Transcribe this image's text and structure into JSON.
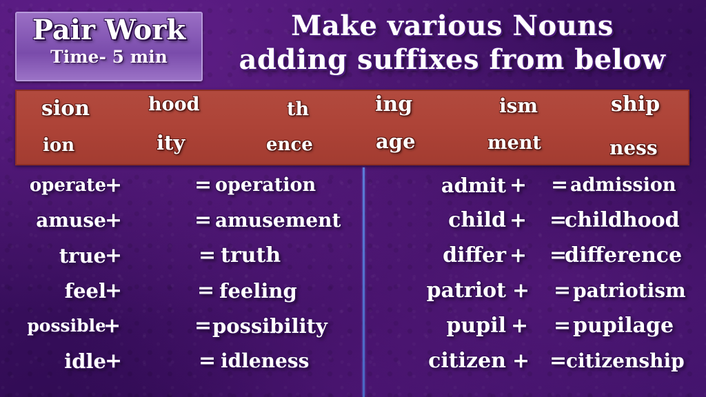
{
  "badge": {
    "title": "Pair Work",
    "subtitle": "Time- 5 min"
  },
  "heading": {
    "line1": "Make various Nouns",
    "line2": "adding suffixes from below"
  },
  "suffix_bar": {
    "row1": [
      "sion",
      "hood",
      "th",
      "ing",
      "ism",
      "ship"
    ],
    "row2": [
      "ion",
      "ity",
      "ence",
      "age",
      "ment",
      "ness"
    ]
  },
  "left_column": [
    {
      "base": "operate",
      "op": "+",
      "eq": "=",
      "result": "operation"
    },
    {
      "base": "amuse",
      "op": "+",
      "eq": "=",
      "result": "amusement"
    },
    {
      "base": "true",
      "op": "+",
      "eq": "=",
      "result": "truth"
    },
    {
      "base": "feel",
      "op": "+",
      "eq": "=",
      "result": "feeling"
    },
    {
      "base": "possible",
      "op": "+",
      "eq": "=",
      "result": "possibility"
    },
    {
      "base": "idle",
      "op": "+",
      "eq": "=",
      "result": "idleness"
    }
  ],
  "right_column": [
    {
      "base": "admit",
      "op": "+",
      "eq": "=",
      "result": "admission"
    },
    {
      "base": "child",
      "op": "+",
      "eq": "=",
      "result": "childhood"
    },
    {
      "base": "differ",
      "op": "+",
      "eq": "=",
      "result": "difference"
    },
    {
      "base": "patriot",
      "op": "+",
      "eq": "=",
      "result": "patriotism"
    },
    {
      "base": "pupil",
      "op": "+",
      "eq": "=",
      "result": "pupilage"
    },
    {
      "base": "citizen",
      "op": "+",
      "eq": "=",
      "result": "citizenship"
    }
  ],
  "colors": {
    "background": "#3b1060",
    "badge": "#8457b4",
    "suffix_bar": "#ad4337",
    "text": "#ffffff",
    "divider": "#4a66c2"
  }
}
